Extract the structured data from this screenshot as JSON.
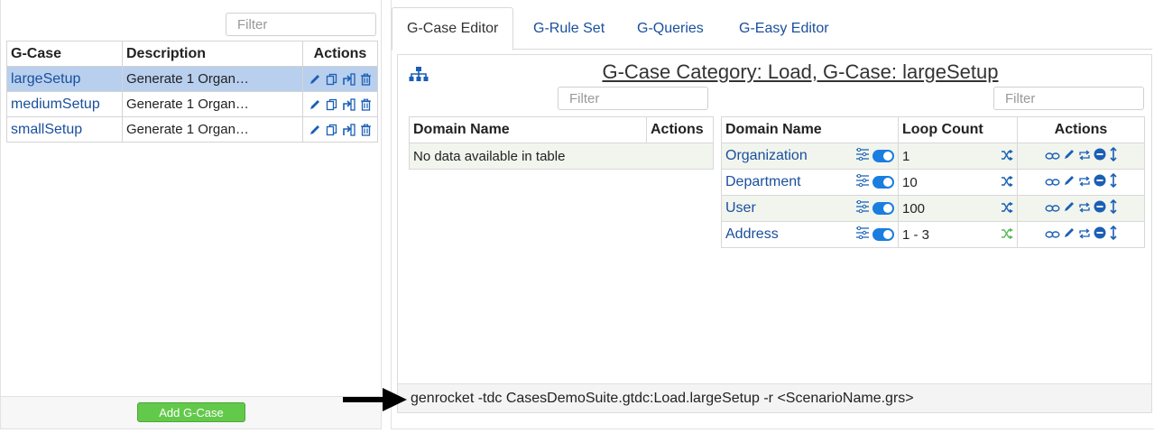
{
  "colors": {
    "link": "#1a4f9c",
    "selected_row": "#b8cfee",
    "add_button": "#63c94b",
    "icon_blue": "#1a5fb4",
    "toggle_blue": "#1a7de0",
    "shuffle_green": "#5cb85c"
  },
  "left_panel": {
    "filter_placeholder": "Filter",
    "table": {
      "headers": [
        "G-Case",
        "Description",
        "Actions"
      ],
      "rows": [
        {
          "name": "largeSetup",
          "description": "Generate 1 Organ…",
          "selected": true
        },
        {
          "name": "mediumSetup",
          "description": "Generate 1 Organ…",
          "selected": false
        },
        {
          "name": "smallSetup",
          "description": "Generate 1 Organ…",
          "selected": false
        }
      ],
      "row_action_icons": [
        "pencil-icon",
        "copy-icon",
        "move-icon",
        "trash-icon"
      ]
    },
    "add_button_label": "Add G-Case"
  },
  "right_panel": {
    "tabs": [
      {
        "label": "G-Case Editor",
        "active": true
      },
      {
        "label": "G-Rule Set",
        "active": false
      },
      {
        "label": "G-Queries",
        "active": false
      },
      {
        "label": "G-Easy Editor",
        "active": false
      }
    ],
    "editor": {
      "title": "G-Case Category: Load, G-Case: largeSetup",
      "left_filter_placeholder": "Filter",
      "right_filter_placeholder": "Filter",
      "left_table": {
        "headers": [
          "Domain Name",
          "Actions"
        ],
        "empty_message": "No data available in table"
      },
      "right_table": {
        "headers": [
          "Domain Name",
          "Loop Count",
          "Actions"
        ],
        "rows": [
          {
            "domain": "Organization",
            "loop_count": "1",
            "shuffle_icon": "shuffle-icon"
          },
          {
            "domain": "Department",
            "loop_count": "10",
            "shuffle_icon": "shuffle-icon"
          },
          {
            "domain": "User",
            "loop_count": "100",
            "shuffle_icon": "shuffle-icon"
          },
          {
            "domain": "Address",
            "loop_count": "1 - 3",
            "shuffle_icon": "shuffle-green-icon"
          }
        ],
        "row_action_icons": [
          "link-icon",
          "pencil-icon",
          "repeat-icon",
          "minus-circle-icon",
          "vertical-arrows-icon"
        ]
      },
      "command": "genrocket -tdc CasesDemoSuite.gtdc:Load.largeSetup -r <ScenarioName.grs>"
    }
  }
}
